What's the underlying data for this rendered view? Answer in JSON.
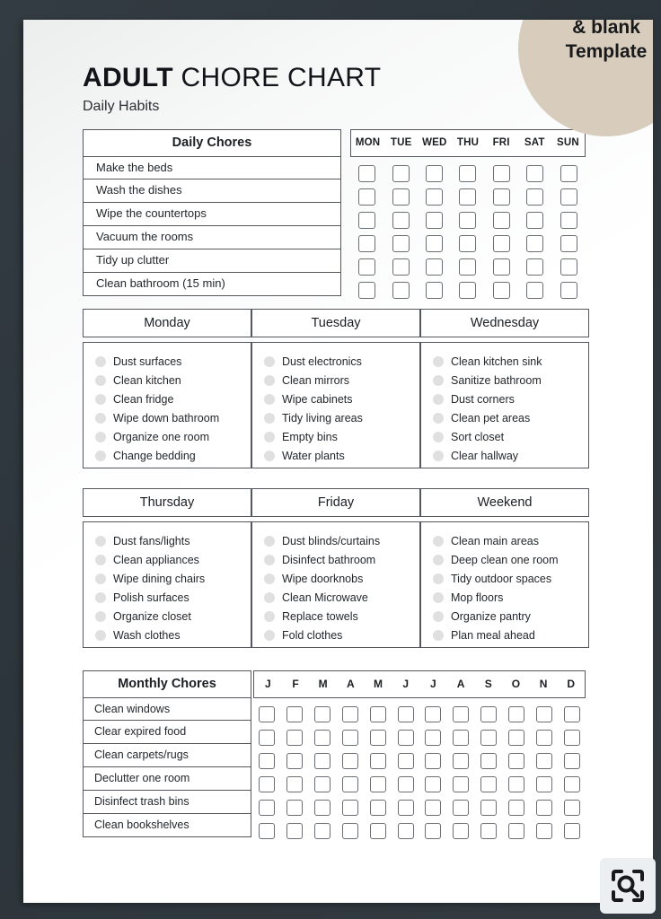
{
  "sticker": {
    "line1": "& blank",
    "line2": "Template",
    "color": "#d8cdbd"
  },
  "header": {
    "title_bold": "ADULT",
    "title_rest": " CHORE CHART",
    "subtitle": "Daily Habits"
  },
  "daily_chores": {
    "heading": "Daily Chores",
    "items": [
      "Make the beds",
      "Wash the dishes",
      "Wipe the countertops",
      "Vacuum the rooms",
      "Tidy up clutter",
      "Clean bathroom (15 min)"
    ]
  },
  "week_grid": {
    "day_headers": [
      "MON",
      "TUE",
      "WED",
      "THU",
      "FRI",
      "SAT",
      "SUN"
    ],
    "rows": 6,
    "columns": 7
  },
  "day_cards": [
    {
      "title": "Monday",
      "tasks": [
        "Dust surfaces",
        "Clean kitchen",
        "Clean fridge",
        "Wipe down bathroom",
        "Organize one room",
        "Change bedding"
      ]
    },
    {
      "title": "Tuesday",
      "tasks": [
        "Dust electronics",
        "Clean mirrors",
        "Wipe cabinets",
        "Tidy living areas",
        "Empty bins",
        "Water plants"
      ]
    },
    {
      "title": "Wednesday",
      "tasks": [
        "Clean kitchen sink",
        "Sanitize bathroom",
        "Dust corners",
        "Clean pet areas",
        "Sort closet",
        "Clear hallway"
      ]
    },
    {
      "title": "Thursday",
      "tasks": [
        "Dust fans/lights",
        "Clean appliances",
        "Wipe dining chairs",
        "Polish surfaces",
        "Organize closet",
        "Wash clothes"
      ]
    },
    {
      "title": "Friday",
      "tasks": [
        "Dust blinds/curtains",
        "Disinfect bathroom",
        "Wipe doorknobs",
        "Clean Microwave",
        "Replace towels",
        "Fold clothes"
      ]
    },
    {
      "title": "Weekend",
      "tasks": [
        "Clean main areas",
        "Deep clean one room",
        "Tidy outdoor spaces",
        "Mop floors",
        "Organize pantry",
        "Plan meal ahead"
      ]
    }
  ],
  "monthly_chores": {
    "heading": "Monthly Chores",
    "items": [
      "Clean windows",
      "Clear expired food",
      "Clean carpets/rugs",
      "Declutter one room",
      "Disinfect trash bins",
      "Clean bookshelves"
    ]
  },
  "month_grid": {
    "month_headers": [
      "J",
      "F",
      "M",
      "A",
      "M",
      "J",
      "J",
      "A",
      "S",
      "O",
      "N",
      "D"
    ],
    "rows": 6,
    "columns": 12
  },
  "overlay": {
    "lens_button_name": "visual-search-lens"
  }
}
